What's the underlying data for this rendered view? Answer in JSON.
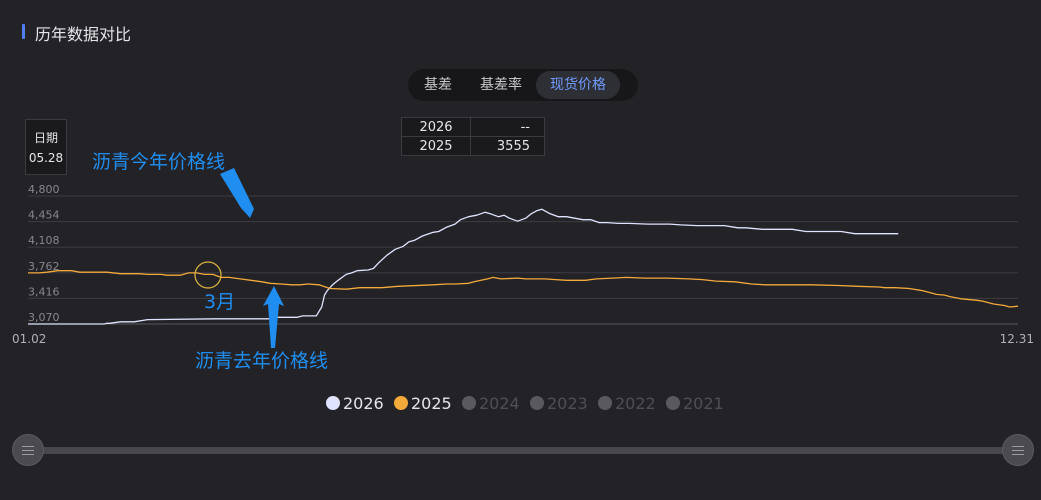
{
  "panel": {
    "title": "历年数据对比"
  },
  "tabs": [
    {
      "label": "基差",
      "active": false
    },
    {
      "label": "基差率",
      "active": false
    },
    {
      "label": "现货价格",
      "active": true
    }
  ],
  "tooltip": {
    "date_label": "日期",
    "date_value": "05.28",
    "rows": [
      {
        "year": "2026",
        "value": "--"
      },
      {
        "year": "2025",
        "value": "3555"
      }
    ]
  },
  "annotations": {
    "this_year": "沥青今年价格线",
    "last_year": "沥青去年价格线",
    "month": "3月",
    "color": "#1f8ef0"
  },
  "chart_data": {
    "type": "line",
    "x_start_label": "01.02",
    "x_end_label": "12.31",
    "x_range": [
      1,
      365
    ],
    "y_ticks": [
      "3,070",
      "3,416",
      "3,762",
      "4,108",
      "4,454",
      "4,800"
    ],
    "ylim": [
      3070,
      4800
    ],
    "grid": true,
    "legend_placement": "bottom",
    "series": [
      {
        "name": "2026",
        "color": "#dfe3ff",
        "legend_color": "#dfe3ff",
        "active": true,
        "points": [
          [
            1,
            3070
          ],
          [
            29,
            3070
          ],
          [
            30,
            3080
          ],
          [
            31,
            3080
          ],
          [
            35,
            3100
          ],
          [
            40,
            3100
          ],
          [
            45,
            3130
          ],
          [
            70,
            3140
          ],
          [
            90,
            3140
          ],
          [
            92,
            3160
          ],
          [
            100,
            3160
          ],
          [
            102,
            3180
          ],
          [
            107,
            3180
          ],
          [
            108,
            3240
          ],
          [
            109,
            3300
          ],
          [
            110,
            3460
          ],
          [
            111,
            3520
          ],
          [
            113,
            3600
          ],
          [
            115,
            3660
          ],
          [
            118,
            3740
          ],
          [
            120,
            3760
          ],
          [
            122,
            3790
          ],
          [
            126,
            3800
          ],
          [
            128,
            3820
          ],
          [
            130,
            3900
          ],
          [
            133,
            4000
          ],
          [
            136,
            4080
          ],
          [
            139,
            4120
          ],
          [
            141,
            4180
          ],
          [
            143,
            4200
          ],
          [
            146,
            4260
          ],
          [
            150,
            4310
          ],
          [
            152,
            4320
          ],
          [
            155,
            4380
          ],
          [
            158,
            4420
          ],
          [
            160,
            4480
          ],
          [
            163,
            4520
          ],
          [
            166,
            4540
          ],
          [
            169,
            4580
          ],
          [
            171,
            4560
          ],
          [
            174,
            4520
          ],
          [
            176,
            4540
          ],
          [
            178,
            4500
          ],
          [
            181,
            4460
          ],
          [
            184,
            4500
          ],
          [
            186,
            4560
          ],
          [
            188,
            4600
          ],
          [
            190,
            4620
          ],
          [
            193,
            4560
          ],
          [
            196,
            4520
          ],
          [
            199,
            4520
          ],
          [
            202,
            4500
          ],
          [
            205,
            4480
          ],
          [
            208,
            4480
          ],
          [
            211,
            4440
          ],
          [
            214,
            4440
          ],
          [
            218,
            4430
          ],
          [
            222,
            4430
          ],
          [
            229,
            4420
          ],
          [
            237,
            4420
          ],
          [
            241,
            4410
          ],
          [
            247,
            4400
          ],
          [
            253,
            4400
          ],
          [
            257,
            4400
          ],
          [
            262,
            4370
          ],
          [
            265,
            4370
          ],
          [
            271,
            4350
          ],
          [
            276,
            4350
          ],
          [
            282,
            4350
          ],
          [
            287,
            4320
          ],
          [
            293,
            4320
          ],
          [
            300,
            4320
          ],
          [
            305,
            4290
          ],
          [
            310,
            4290
          ],
          [
            318,
            4290
          ],
          [
            321,
            4290
          ]
        ]
      },
      {
        "name": "2025",
        "color": "#f4a93b",
        "legend_color": "#f4a93b",
        "active": true,
        "points": [
          [
            1,
            3760
          ],
          [
            5,
            3760
          ],
          [
            8,
            3770
          ],
          [
            12,
            3790
          ],
          [
            17,
            3790
          ],
          [
            20,
            3770
          ],
          [
            25,
            3770
          ],
          [
            30,
            3770
          ],
          [
            35,
            3750
          ],
          [
            42,
            3750
          ],
          [
            45,
            3740
          ],
          [
            50,
            3740
          ],
          [
            52,
            3730
          ],
          [
            57,
            3730
          ],
          [
            60,
            3760
          ],
          [
            63,
            3760
          ],
          [
            66,
            3740
          ],
          [
            69,
            3740
          ],
          [
            72,
            3700
          ],
          [
            75,
            3700
          ],
          [
            79,
            3680
          ],
          [
            83,
            3660
          ],
          [
            87,
            3640
          ],
          [
            90,
            3620
          ],
          [
            94,
            3610
          ],
          [
            98,
            3600
          ],
          [
            101,
            3600
          ],
          [
            104,
            3610
          ],
          [
            108,
            3600
          ],
          [
            112,
            3550
          ],
          [
            118,
            3540
          ],
          [
            123,
            3560
          ],
          [
            131,
            3560
          ],
          [
            137,
            3580
          ],
          [
            150,
            3600
          ],
          [
            155,
            3610
          ],
          [
            158,
            3610
          ],
          [
            163,
            3620
          ],
          [
            165,
            3640
          ],
          [
            170,
            3680
          ],
          [
            172,
            3700
          ],
          [
            175,
            3680
          ],
          [
            181,
            3690
          ],
          [
            184,
            3680
          ],
          [
            191,
            3680
          ],
          [
            195,
            3670
          ],
          [
            199,
            3660
          ],
          [
            206,
            3660
          ],
          [
            210,
            3680
          ],
          [
            216,
            3690
          ],
          [
            221,
            3700
          ],
          [
            228,
            3690
          ],
          [
            236,
            3690
          ],
          [
            244,
            3680
          ],
          [
            249,
            3670
          ],
          [
            254,
            3650
          ],
          [
            261,
            3640
          ],
          [
            267,
            3610
          ],
          [
            272,
            3600
          ],
          [
            280,
            3600
          ],
          [
            289,
            3600
          ],
          [
            299,
            3590
          ],
          [
            306,
            3580
          ],
          [
            314,
            3570
          ],
          [
            316,
            3560
          ],
          [
            320,
            3560
          ],
          [
            325,
            3550
          ],
          [
            330,
            3520
          ],
          [
            333,
            3490
          ],
          [
            335,
            3470
          ],
          [
            338,
            3460
          ],
          [
            340,
            3440
          ],
          [
            344,
            3410
          ],
          [
            350,
            3390
          ],
          [
            352,
            3380
          ],
          [
            356,
            3340
          ],
          [
            360,
            3320
          ],
          [
            362,
            3300
          ],
          [
            365,
            3310
          ]
        ]
      },
      {
        "name": "2024",
        "legend_color": "#5a5a5e",
        "active": false
      },
      {
        "name": "2023",
        "legend_color": "#5a5a5e",
        "active": false
      },
      {
        "name": "2022",
        "legend_color": "#5a5a5e",
        "active": false
      },
      {
        "name": "2021",
        "legend_color": "#5a5a5e",
        "active": false
      }
    ]
  }
}
